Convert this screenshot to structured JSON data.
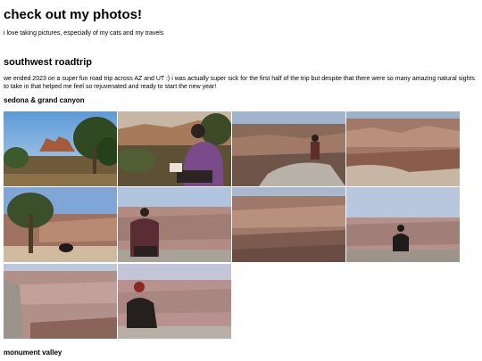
{
  "header": {
    "title": "check out my photos!"
  },
  "intro": "i love taking pictures, especially of my cats and my travels",
  "section": {
    "title": "southwest roadtrip",
    "description": "we ended 2023 on a super fun road trip across AZ and UT :) i was actually super sick for the first half of the trip but despite that there were so many amazing natural sights to take in that helped me feel so rejuvenated and ready to start the new year!"
  },
  "albums": [
    {
      "title": "sedona & grand canyon"
    },
    {
      "title": "monument valley"
    }
  ]
}
